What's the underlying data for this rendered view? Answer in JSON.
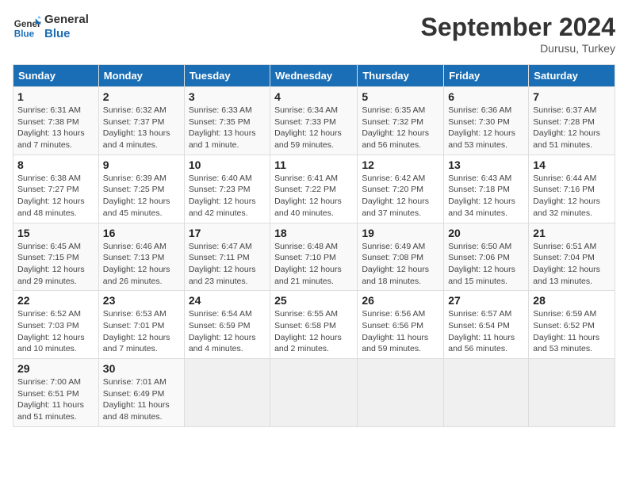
{
  "logo": {
    "line1": "General",
    "line2": "Blue"
  },
  "title": "September 2024",
  "subtitle": "Durusu, Turkey",
  "headers": [
    "Sunday",
    "Monday",
    "Tuesday",
    "Wednesday",
    "Thursday",
    "Friday",
    "Saturday"
  ],
  "weeks": [
    [
      {
        "day": "1",
        "sunrise": "Sunrise: 6:31 AM",
        "sunset": "Sunset: 7:38 PM",
        "daylight": "Daylight: 13 hours and 7 minutes."
      },
      {
        "day": "2",
        "sunrise": "Sunrise: 6:32 AM",
        "sunset": "Sunset: 7:37 PM",
        "daylight": "Daylight: 13 hours and 4 minutes."
      },
      {
        "day": "3",
        "sunrise": "Sunrise: 6:33 AM",
        "sunset": "Sunset: 7:35 PM",
        "daylight": "Daylight: 13 hours and 1 minute."
      },
      {
        "day": "4",
        "sunrise": "Sunrise: 6:34 AM",
        "sunset": "Sunset: 7:33 PM",
        "daylight": "Daylight: 12 hours and 59 minutes."
      },
      {
        "day": "5",
        "sunrise": "Sunrise: 6:35 AM",
        "sunset": "Sunset: 7:32 PM",
        "daylight": "Daylight: 12 hours and 56 minutes."
      },
      {
        "day": "6",
        "sunrise": "Sunrise: 6:36 AM",
        "sunset": "Sunset: 7:30 PM",
        "daylight": "Daylight: 12 hours and 53 minutes."
      },
      {
        "day": "7",
        "sunrise": "Sunrise: 6:37 AM",
        "sunset": "Sunset: 7:28 PM",
        "daylight": "Daylight: 12 hours and 51 minutes."
      }
    ],
    [
      {
        "day": "8",
        "sunrise": "Sunrise: 6:38 AM",
        "sunset": "Sunset: 7:27 PM",
        "daylight": "Daylight: 12 hours and 48 minutes."
      },
      {
        "day": "9",
        "sunrise": "Sunrise: 6:39 AM",
        "sunset": "Sunset: 7:25 PM",
        "daylight": "Daylight: 12 hours and 45 minutes."
      },
      {
        "day": "10",
        "sunrise": "Sunrise: 6:40 AM",
        "sunset": "Sunset: 7:23 PM",
        "daylight": "Daylight: 12 hours and 42 minutes."
      },
      {
        "day": "11",
        "sunrise": "Sunrise: 6:41 AM",
        "sunset": "Sunset: 7:22 PM",
        "daylight": "Daylight: 12 hours and 40 minutes."
      },
      {
        "day": "12",
        "sunrise": "Sunrise: 6:42 AM",
        "sunset": "Sunset: 7:20 PM",
        "daylight": "Daylight: 12 hours and 37 minutes."
      },
      {
        "day": "13",
        "sunrise": "Sunrise: 6:43 AM",
        "sunset": "Sunset: 7:18 PM",
        "daylight": "Daylight: 12 hours and 34 minutes."
      },
      {
        "day": "14",
        "sunrise": "Sunrise: 6:44 AM",
        "sunset": "Sunset: 7:16 PM",
        "daylight": "Daylight: 12 hours and 32 minutes."
      }
    ],
    [
      {
        "day": "15",
        "sunrise": "Sunrise: 6:45 AM",
        "sunset": "Sunset: 7:15 PM",
        "daylight": "Daylight: 12 hours and 29 minutes."
      },
      {
        "day": "16",
        "sunrise": "Sunrise: 6:46 AM",
        "sunset": "Sunset: 7:13 PM",
        "daylight": "Daylight: 12 hours and 26 minutes."
      },
      {
        "day": "17",
        "sunrise": "Sunrise: 6:47 AM",
        "sunset": "Sunset: 7:11 PM",
        "daylight": "Daylight: 12 hours and 23 minutes."
      },
      {
        "day": "18",
        "sunrise": "Sunrise: 6:48 AM",
        "sunset": "Sunset: 7:10 PM",
        "daylight": "Daylight: 12 hours and 21 minutes."
      },
      {
        "day": "19",
        "sunrise": "Sunrise: 6:49 AM",
        "sunset": "Sunset: 7:08 PM",
        "daylight": "Daylight: 12 hours and 18 minutes."
      },
      {
        "day": "20",
        "sunrise": "Sunrise: 6:50 AM",
        "sunset": "Sunset: 7:06 PM",
        "daylight": "Daylight: 12 hours and 15 minutes."
      },
      {
        "day": "21",
        "sunrise": "Sunrise: 6:51 AM",
        "sunset": "Sunset: 7:04 PM",
        "daylight": "Daylight: 12 hours and 13 minutes."
      }
    ],
    [
      {
        "day": "22",
        "sunrise": "Sunrise: 6:52 AM",
        "sunset": "Sunset: 7:03 PM",
        "daylight": "Daylight: 12 hours and 10 minutes."
      },
      {
        "day": "23",
        "sunrise": "Sunrise: 6:53 AM",
        "sunset": "Sunset: 7:01 PM",
        "daylight": "Daylight: 12 hours and 7 minutes."
      },
      {
        "day": "24",
        "sunrise": "Sunrise: 6:54 AM",
        "sunset": "Sunset: 6:59 PM",
        "daylight": "Daylight: 12 hours and 4 minutes."
      },
      {
        "day": "25",
        "sunrise": "Sunrise: 6:55 AM",
        "sunset": "Sunset: 6:58 PM",
        "daylight": "Daylight: 12 hours and 2 minutes."
      },
      {
        "day": "26",
        "sunrise": "Sunrise: 6:56 AM",
        "sunset": "Sunset: 6:56 PM",
        "daylight": "Daylight: 11 hours and 59 minutes."
      },
      {
        "day": "27",
        "sunrise": "Sunrise: 6:57 AM",
        "sunset": "Sunset: 6:54 PM",
        "daylight": "Daylight: 11 hours and 56 minutes."
      },
      {
        "day": "28",
        "sunrise": "Sunrise: 6:59 AM",
        "sunset": "Sunset: 6:52 PM",
        "daylight": "Daylight: 11 hours and 53 minutes."
      }
    ],
    [
      {
        "day": "29",
        "sunrise": "Sunrise: 7:00 AM",
        "sunset": "Sunset: 6:51 PM",
        "daylight": "Daylight: 11 hours and 51 minutes."
      },
      {
        "day": "30",
        "sunrise": "Sunrise: 7:01 AM",
        "sunset": "Sunset: 6:49 PM",
        "daylight": "Daylight: 11 hours and 48 minutes."
      },
      {
        "day": "",
        "sunrise": "",
        "sunset": "",
        "daylight": ""
      },
      {
        "day": "",
        "sunrise": "",
        "sunset": "",
        "daylight": ""
      },
      {
        "day": "",
        "sunrise": "",
        "sunset": "",
        "daylight": ""
      },
      {
        "day": "",
        "sunrise": "",
        "sunset": "",
        "daylight": ""
      },
      {
        "day": "",
        "sunrise": "",
        "sunset": "",
        "daylight": ""
      }
    ]
  ]
}
